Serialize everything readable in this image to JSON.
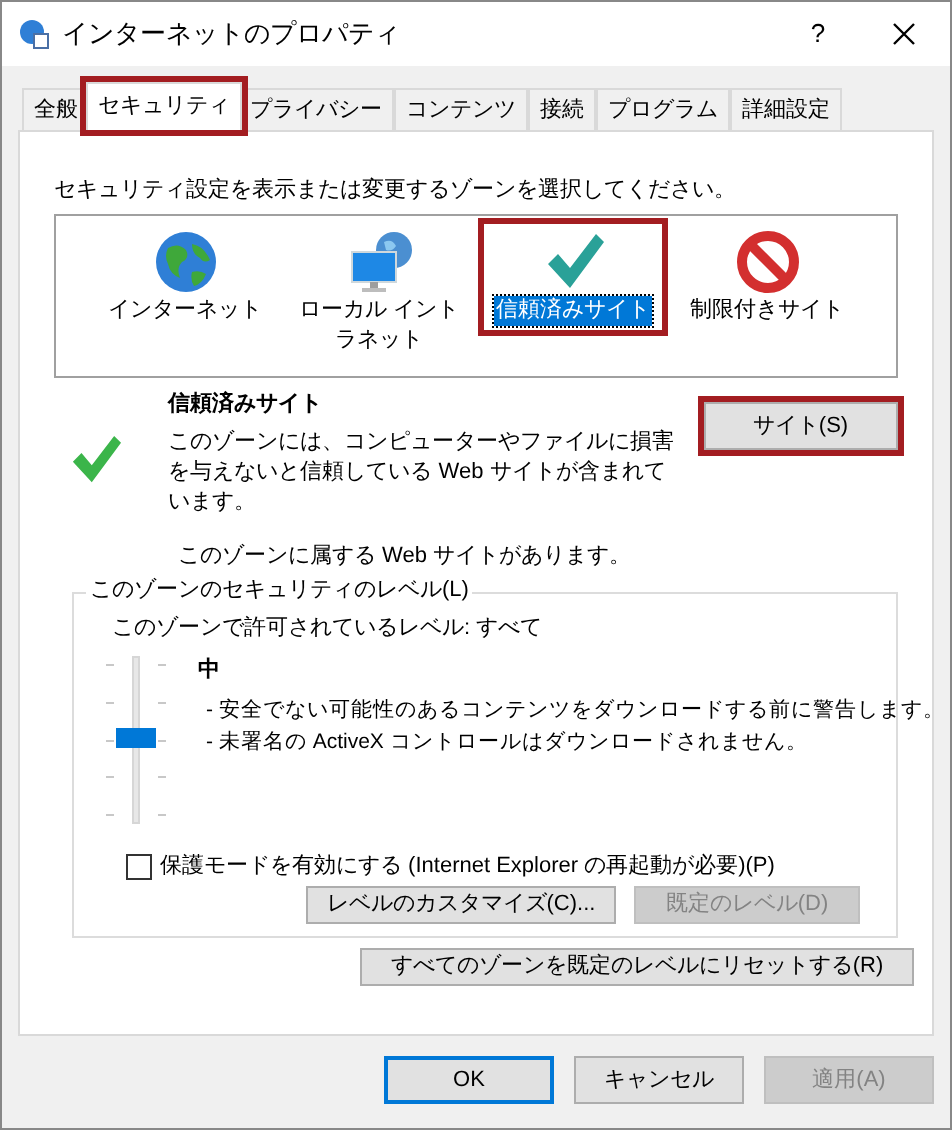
{
  "window": {
    "title": "インターネットのプロパティ",
    "help": "?"
  },
  "tabs": [
    {
      "label": "全般",
      "selected": false,
      "highlighted": false
    },
    {
      "label": "セキュリティ",
      "selected": true,
      "highlighted": true
    },
    {
      "label": "プライバシー",
      "selected": false,
      "highlighted": false
    },
    {
      "label": "コンテンツ",
      "selected": false,
      "highlighted": false
    },
    {
      "label": "接続",
      "selected": false,
      "highlighted": false
    },
    {
      "label": "プログラム",
      "selected": false,
      "highlighted": false
    },
    {
      "label": "詳細設定",
      "selected": false,
      "highlighted": false
    }
  ],
  "zone_prompt": "セキュリティ設定を表示または変更するゾーンを選択してください。",
  "zones": [
    {
      "kind": "globe",
      "label": "インターネット",
      "selected": false,
      "highlighted": false
    },
    {
      "kind": "intranet",
      "label": "ローカル イントラネット",
      "selected": false,
      "highlighted": false
    },
    {
      "kind": "check",
      "label": "信頼済みサイト",
      "selected": true,
      "highlighted": true
    },
    {
      "kind": "restricted",
      "label": "制限付きサイト",
      "selected": false,
      "highlighted": false
    }
  ],
  "zone_info": {
    "title": "信頼済みサイト",
    "description": "このゾーンには、コンピューターやファイルに損害を与えないと信頼している Web サイトが含まれています。",
    "sites_button": {
      "label": "サイト(S)",
      "highlighted": true
    },
    "note": "このゾーンに属する Web サイトがあります。"
  },
  "security_level": {
    "legend": "このゾーンのセキュリティのレベル(L)",
    "allowed": "このゾーンで許可されているレベル: すべて",
    "level": 0.5,
    "level_name": "中",
    "details": [
      "- 安全でない可能性のあるコンテンツをダウンロードする前に警告します。",
      "- 未署名の ActiveX コントロールはダウンロードされません。"
    ],
    "protected_mode": {
      "label": "保護モードを有効にする (Internet Explorer の再起動が必要)(P)",
      "checked": false
    },
    "buttons": [
      {
        "label": "レベルのカスタマイズ(C)...",
        "disabled": false
      },
      {
        "label": "既定のレベル(D)",
        "disabled": true
      }
    ]
  },
  "reset_button": "すべてのゾーンを既定のレベルにリセットする(R)",
  "dialog_buttons": [
    {
      "label": "OK",
      "default": true,
      "disabled": false
    },
    {
      "label": "キャンセル",
      "default": false,
      "disabled": false
    },
    {
      "label": "適用(A)",
      "default": false,
      "disabled": true
    }
  ]
}
